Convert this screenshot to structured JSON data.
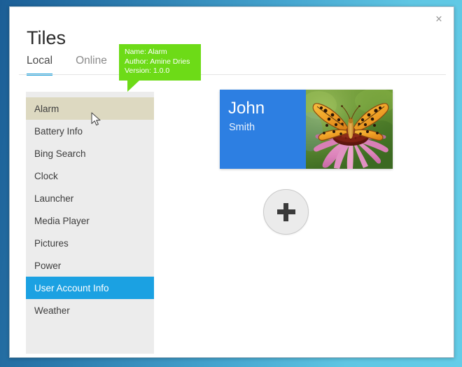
{
  "window": {
    "close_label": "×"
  },
  "header": {
    "title": "Tiles",
    "tabs": [
      {
        "label": "Local",
        "active": true
      },
      {
        "label": "Online",
        "active": false
      }
    ]
  },
  "tooltip": {
    "name_line": "Name: Alarm",
    "author_line": "Author: Amine Dries",
    "version_line": "Version: 1.0.0",
    "background_color": "#6ddb17",
    "text_color": "#ffffff"
  },
  "sidebar": {
    "items": [
      {
        "label": "Alarm",
        "state": "hover"
      },
      {
        "label": "Battery Info",
        "state": "normal"
      },
      {
        "label": "Bing Search",
        "state": "normal"
      },
      {
        "label": "Clock",
        "state": "normal"
      },
      {
        "label": "Launcher",
        "state": "normal"
      },
      {
        "label": "Media Player",
        "state": "normal"
      },
      {
        "label": "Pictures",
        "state": "normal"
      },
      {
        "label": "Power",
        "state": "normal"
      },
      {
        "label": "User Account Info",
        "state": "selected"
      },
      {
        "label": "Weather",
        "state": "normal"
      }
    ],
    "background_color": "#ececec",
    "hover_color": "#ddd9c1",
    "selected_color": "#1ba1e2"
  },
  "main": {
    "user_tile": {
      "first_name": "John",
      "last_name": "Smith",
      "tile_color": "#2d7fe2",
      "image_name": "butterfly-on-coneflower-photo"
    },
    "add_button": {
      "icon": "plus-icon",
      "label": ""
    }
  },
  "cursor": {
    "icon": "arrow-cursor"
  },
  "theme": {
    "accent": "#1ba1e2",
    "tab_underline": "#22a3dd",
    "desktop_gradient_from": "#1b5e96",
    "desktop_gradient_to": "#63cde8"
  }
}
